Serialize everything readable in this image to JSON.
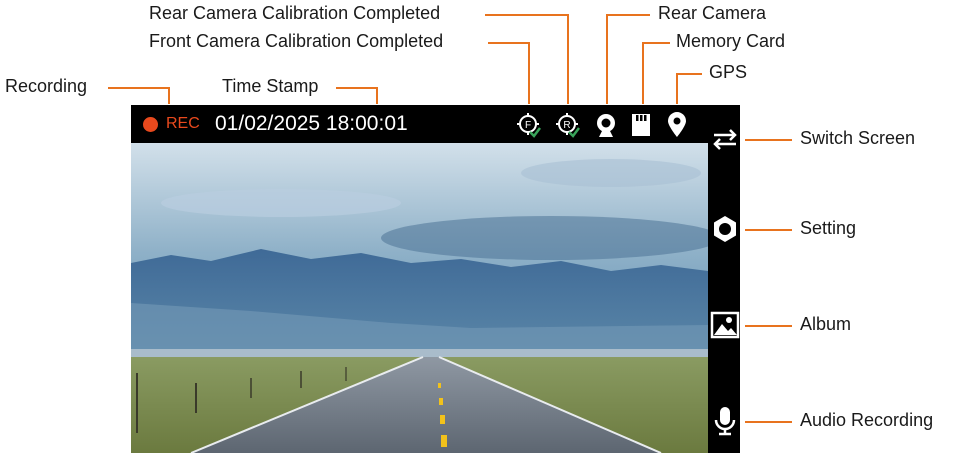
{
  "callouts": {
    "rear_calibration": "Rear Camera Calibration Completed",
    "front_calibration": "Front Camera Calibration Completed",
    "rear_camera": "Rear Camera",
    "memory_card": "Memory Card",
    "gps": "GPS",
    "recording": "Recording",
    "time_stamp": "Time Stamp",
    "switch_screen": "Switch Screen",
    "setting": "Setting",
    "album": "Album",
    "audio_recording": "Audio Recording"
  },
  "screen": {
    "rec_label": "REC",
    "timestamp": "01/02/2025 18:00:01",
    "status_icons": [
      "front-calibration-icon",
      "rear-calibration-icon",
      "rear-camera-icon",
      "memory-card-icon",
      "gps-pin-icon"
    ],
    "front_letter": "F",
    "rear_letter": "R",
    "side_buttons": [
      "switch-screen-icon",
      "settings-hexagon-icon",
      "album-image-icon",
      "microphone-icon"
    ]
  },
  "colors": {
    "accent_orange": "#e8731e",
    "rec_red": "#e8491d",
    "check_green": "#3aa35a"
  }
}
